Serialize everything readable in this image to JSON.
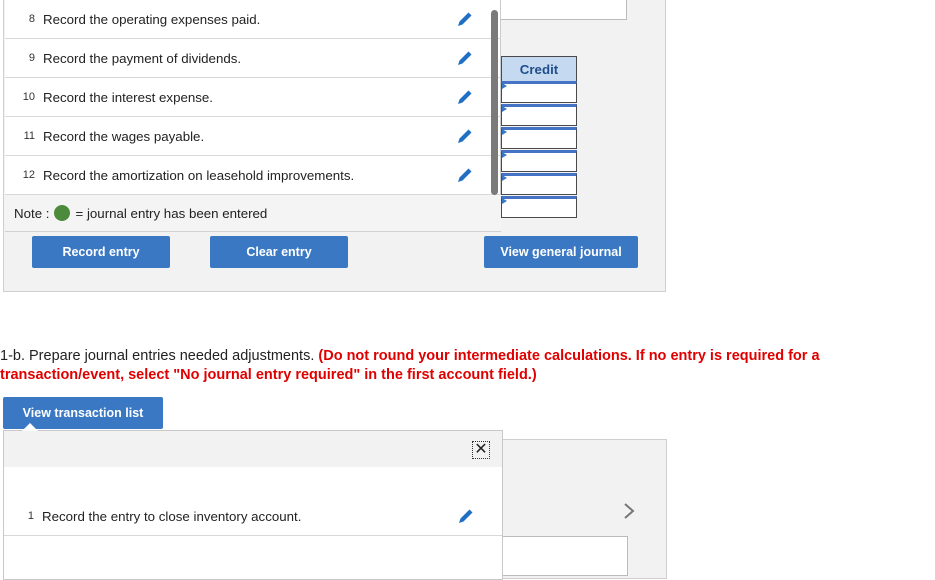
{
  "transactions": {
    "items": [
      {
        "num": "8",
        "label": "Record the operating expenses paid."
      },
      {
        "num": "9",
        "label": "Record the payment of dividends."
      },
      {
        "num": "10",
        "label": "Record the interest expense."
      },
      {
        "num": "11",
        "label": "Record the wages payable."
      },
      {
        "num": "12",
        "label": "Record the amortization on leasehold improvements."
      }
    ],
    "note_label": "Note :",
    "note_text": "= journal entry has been entered"
  },
  "worksheet": {
    "credit_header": "Credit",
    "credit_cells": [
      "",
      "",
      "",
      "",
      ""
    ]
  },
  "buttons": {
    "record_entry": "Record entry",
    "clear_entry": "Clear entry",
    "view_general_journal": "View general journal",
    "view_transaction_list": "View transaction list"
  },
  "instructions": {
    "prefix": "1-b. Prepare journal entries needed adjustments.",
    "emphasis": "(Do not round your intermediate calculations. If no entry is required for a transaction/event, select \"No journal entry required\" in the first account field.)"
  },
  "popup": {
    "close_symbol": "✕",
    "items": [
      {
        "num": "1",
        "label": "Record the entry to close inventory account."
      }
    ]
  },
  "colors": {
    "button_blue": "#3a78c3",
    "header_blue": "#c5d9f1",
    "entered_green": "#4b8b3b",
    "instruction_red": "#e00000",
    "pencil_blue": "#1f6fc5"
  },
  "icons": {
    "edit": "pencil-icon",
    "close": "close-icon",
    "next": "chevron-right-icon",
    "status": "entered-dot-icon"
  }
}
